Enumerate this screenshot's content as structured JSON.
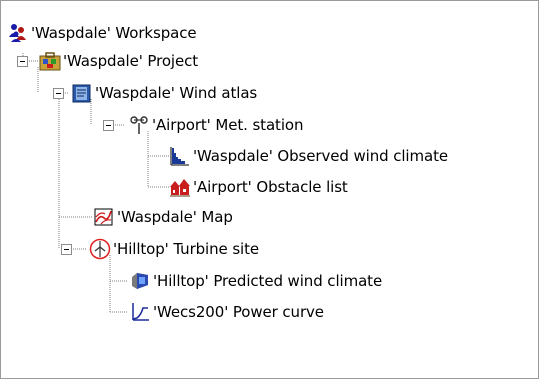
{
  "tree": {
    "workspace": {
      "label": "'Waspdale' Workspace",
      "icon": "workspace-people-icon"
    },
    "project": {
      "label": "'Waspdale' Project",
      "icon": "project-briefcase-icon",
      "expanded": true
    },
    "wind_atlas": {
      "label": "'Waspdale' Wind atlas",
      "icon": "wind-atlas-book-icon",
      "expanded": true
    },
    "met_station": {
      "label": "'Airport' Met. station",
      "icon": "met-station-anemometer-icon",
      "expanded": true
    },
    "observed_wind_climate": {
      "label": "'Waspdale' Observed wind climate",
      "icon": "observed-wind-climate-histogram-icon"
    },
    "obstacle_list": {
      "label": "'Airport' Obstacle list",
      "icon": "obstacle-list-house-icon"
    },
    "map": {
      "label": "'Waspdale' Map",
      "icon": "map-icon"
    },
    "turbine_site": {
      "label": "'Hilltop' Turbine site",
      "icon": "turbine-site-icon",
      "expanded": true
    },
    "predicted_wind_climate": {
      "label": "'Hilltop' Predicted wind climate",
      "icon": "predicted-wind-climate-icon"
    },
    "power_curve": {
      "label": "'Wecs200' Power curve",
      "icon": "power-curve-icon"
    }
  },
  "colors": {
    "tree_line": "#808080",
    "toggle_border": "#8c8c8c",
    "turbine_ring": "#e02020",
    "obstacle_red": "#c81e1e",
    "map_red": "#d01818",
    "power_curve_blue": "#1a2a9a"
  }
}
